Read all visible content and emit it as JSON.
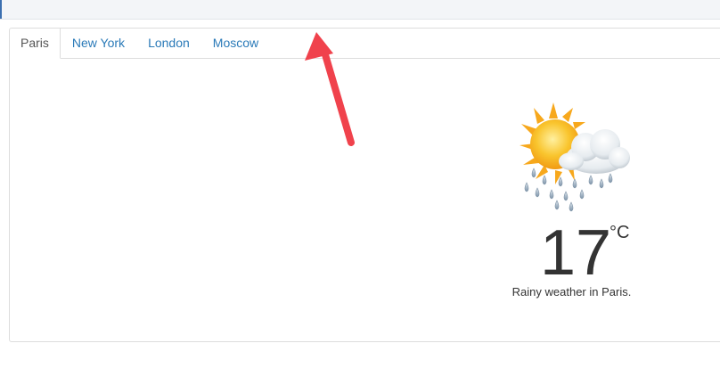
{
  "tabs": [
    {
      "label": "Paris",
      "active": true
    },
    {
      "label": "New York",
      "active": false
    },
    {
      "label": "London",
      "active": false
    },
    {
      "label": "Moscow",
      "active": false
    }
  ],
  "weather": {
    "icon": "sun-cloud-rain-icon",
    "temperature": "17",
    "unit": "°C",
    "description": "Rainy weather in Paris."
  },
  "colors": {
    "tab_link": "#2a7ab8",
    "arrow": "#f0424c",
    "sun": "#f7b21d"
  }
}
